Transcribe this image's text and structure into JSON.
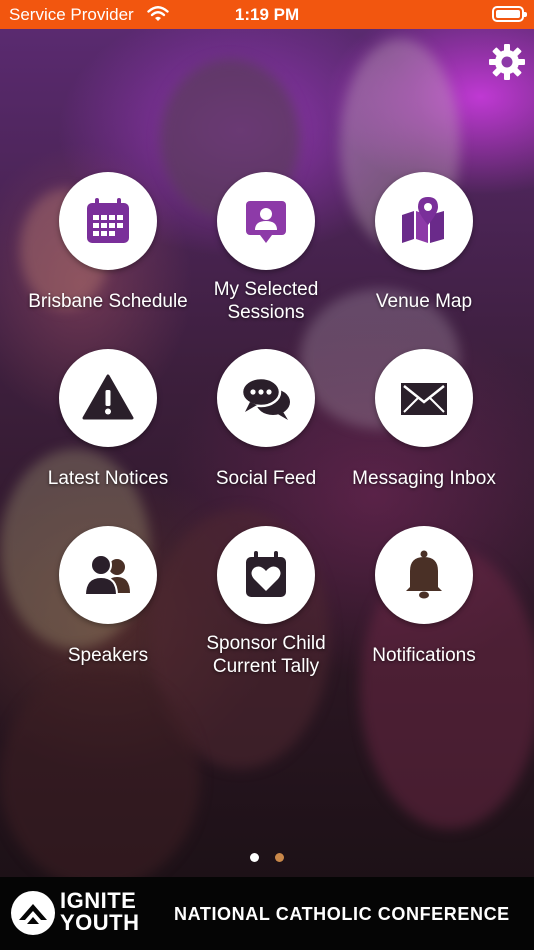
{
  "status_bar": {
    "carrier": "Service Provider",
    "time": "1:19 PM"
  },
  "colors": {
    "status_bar_bg": "#f2560f",
    "icon_accent": "#7a2f9a",
    "icon_dark": "#2a1f2a",
    "page_dot_active": "#ffffff",
    "page_dot_inactive": "#c9884a"
  },
  "settings": {
    "icon": "gear-icon"
  },
  "menu": {
    "items": [
      {
        "label": "Brisbane Schedule",
        "icon": "calendar-icon"
      },
      {
        "label": "My Selected Sessions",
        "icon": "user-badge-icon"
      },
      {
        "label": "Venue Map",
        "icon": "map-pin-icon"
      },
      {
        "label": "Latest Notices",
        "icon": "warning-icon"
      },
      {
        "label": "Social Feed",
        "icon": "chat-bubbles-icon"
      },
      {
        "label": "Messaging Inbox",
        "icon": "envelope-icon"
      },
      {
        "label": "Speakers",
        "icon": "people-icon"
      },
      {
        "label": "Sponsor Child Current Tally",
        "icon": "heart-calendar-icon"
      },
      {
        "label": "Notifications",
        "icon": "bell-icon"
      }
    ]
  },
  "pagination": {
    "current_page": 1,
    "total_pages": 2
  },
  "footer": {
    "logo_line1": "IGNITE",
    "logo_line2": "YOUTH",
    "tagline": "NATIONAL CATHOLIC CONFERENCE"
  }
}
